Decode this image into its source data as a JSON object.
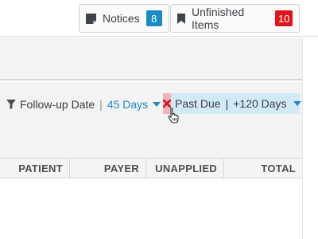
{
  "header": {
    "notices_label": "Notices",
    "notices_count": "8",
    "unfinished_label": "Unfinished Items",
    "unfinished_count": "10",
    "colors": {
      "notices_badge": "#1a8ac6",
      "unfinished_badge": "#e1141d"
    }
  },
  "filters": {
    "followup": {
      "label": "Follow-up Date",
      "separator": "|",
      "value": "45 Days"
    },
    "pastdue": {
      "label": "Past Due",
      "separator": "|",
      "value": "+120 Days"
    }
  },
  "table": {
    "columns": [
      "PATIENT",
      "PAYER",
      "UNAPPLIED",
      "TOTAL"
    ]
  },
  "icons": [
    "note-icon",
    "bookmark-icon",
    "filter-icon",
    "close-icon",
    "caret-down-icon",
    "hand-pointer-cursor-icon"
  ]
}
